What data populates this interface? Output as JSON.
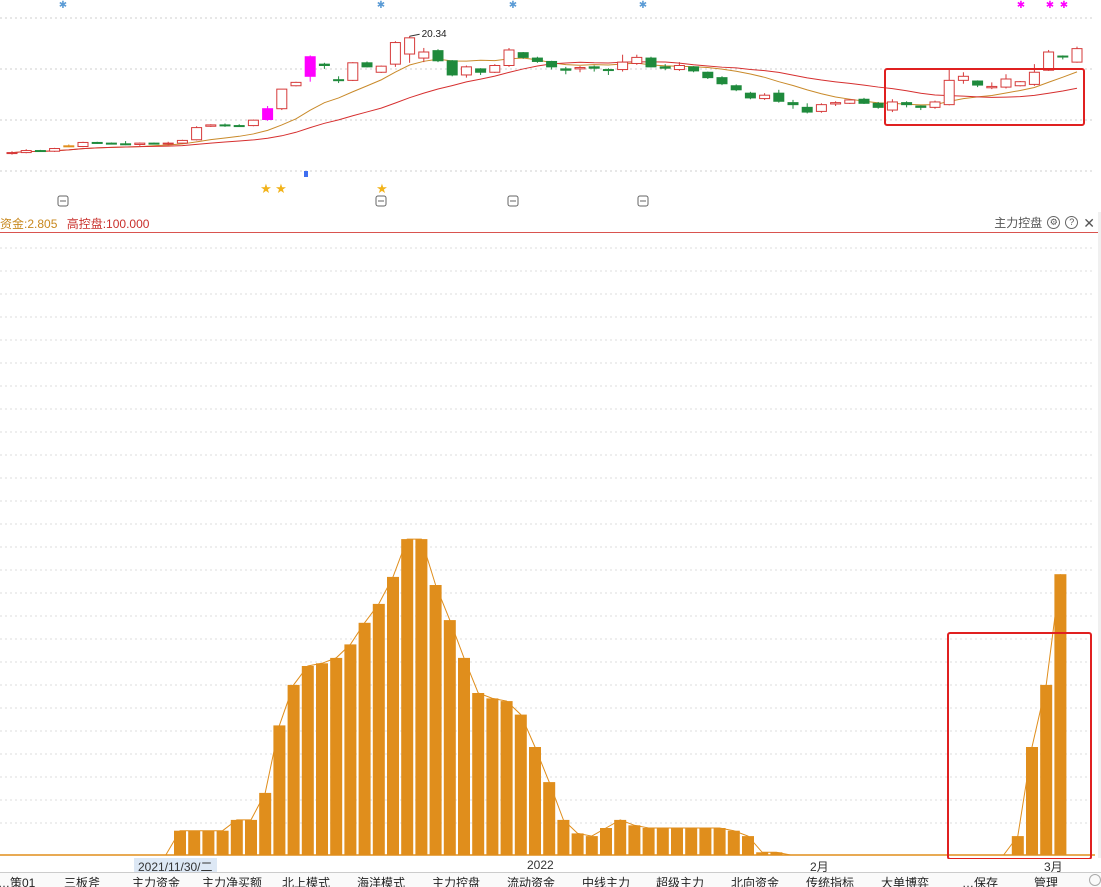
{
  "price_chart": {
    "high_label": "20.34",
    "candles": [
      [
        3.0,
        3.3,
        2.8,
        3.1
      ],
      [
        3.1,
        3.6,
        3.0,
        3.4
      ],
      [
        3.4,
        3.5,
        3.2,
        3.3
      ],
      [
        3.3,
        3.8,
        3.2,
        3.7
      ],
      [
        4.1,
        4.3,
        3.9,
        4.0
      ],
      [
        4.0,
        4.7,
        3.9,
        4.6
      ],
      [
        4.6,
        4.7,
        4.4,
        4.5
      ],
      [
        4.5,
        4.6,
        4.3,
        4.4
      ],
      [
        4.4,
        4.8,
        4.2,
        4.3
      ],
      [
        4.3,
        4.6,
        4.1,
        4.5
      ],
      [
        4.5,
        4.6,
        4.3,
        4.4
      ],
      [
        4.4,
        4.7,
        4.2,
        4.5
      ],
      [
        4.5,
        5.0,
        4.4,
        4.9
      ],
      [
        5.0,
        7.0,
        4.9,
        6.8
      ],
      [
        7.0,
        7.3,
        6.9,
        7.2
      ],
      [
        7.2,
        7.4,
        6.9,
        7.1
      ],
      [
        7.1,
        7.3,
        6.9,
        7.0
      ],
      [
        7.1,
        8.0,
        7.0,
        7.9
      ],
      [
        8.0,
        10.0,
        7.8,
        9.6
      ],
      [
        9.6,
        12.5,
        9.4,
        12.5
      ],
      [
        13.0,
        13.6,
        12.9,
        13.5
      ],
      [
        14.4,
        17.5,
        13.6,
        17.3
      ],
      [
        16.2,
        16.4,
        15.5,
        16.0
      ],
      [
        13.9,
        14.4,
        13.4,
        13.8
      ],
      [
        13.8,
        16.5,
        13.7,
        16.4
      ],
      [
        16.4,
        16.6,
        15.7,
        15.8
      ],
      [
        15.0,
        16.0,
        14.9,
        15.9
      ],
      [
        16.2,
        19.6,
        15.8,
        19.4
      ],
      [
        17.7,
        20.34,
        16.4,
        20.1
      ],
      [
        17.1,
        18.6,
        16.5,
        18.0
      ],
      [
        18.2,
        18.4,
        16.5,
        16.7
      ],
      [
        16.7,
        16.8,
        14.4,
        14.6
      ],
      [
        14.6,
        16.0,
        14.2,
        15.8
      ],
      [
        15.5,
        15.6,
        14.6,
        15.0
      ],
      [
        15.0,
        16.2,
        14.9,
        16.0
      ],
      [
        16.0,
        18.6,
        15.8,
        18.3
      ],
      [
        17.9,
        18.0,
        17.0,
        17.2
      ],
      [
        17.1,
        17.3,
        16.4,
        16.6
      ],
      [
        16.6,
        16.7,
        15.4,
        15.8
      ],
      [
        15.5,
        15.8,
        14.7,
        15.3
      ],
      [
        15.5,
        15.9,
        15.0,
        15.7
      ],
      [
        15.8,
        16.0,
        15.1,
        15.6
      ],
      [
        15.4,
        15.6,
        14.6,
        15.3
      ],
      [
        15.4,
        17.6,
        15.1,
        16.5
      ],
      [
        16.3,
        17.6,
        16.1,
        17.2
      ],
      [
        17.1,
        17.3,
        15.7,
        15.8
      ],
      [
        15.8,
        16.2,
        15.3,
        15.6
      ],
      [
        15.4,
        16.5,
        15.2,
        16.0
      ],
      [
        15.8,
        15.9,
        15.0,
        15.2
      ],
      [
        15.0,
        15.1,
        14.0,
        14.2
      ],
      [
        14.2,
        14.4,
        13.1,
        13.3
      ],
      [
        13.0,
        13.2,
        12.2,
        12.4
      ],
      [
        11.9,
        12.1,
        11.0,
        11.2
      ],
      [
        11.1,
        11.9,
        10.9,
        11.6
      ],
      [
        11.9,
        12.4,
        10.5,
        10.7
      ],
      [
        10.5,
        10.9,
        9.6,
        10.2
      ],
      [
        9.8,
        10.4,
        8.9,
        9.1
      ],
      [
        9.2,
        10.4,
        9.0,
        10.2
      ],
      [
        10.3,
        10.7,
        10.0,
        10.5
      ],
      [
        10.4,
        11.0,
        10.3,
        10.9
      ],
      [
        11.0,
        11.2,
        10.3,
        10.4
      ],
      [
        10.4,
        10.6,
        9.6,
        9.8
      ],
      [
        9.4,
        11.0,
        9.1,
        10.6
      ],
      [
        10.5,
        10.7,
        9.8,
        10.2
      ],
      [
        10.0,
        10.1,
        9.4,
        9.8
      ],
      [
        9.8,
        10.8,
        9.6,
        10.6
      ],
      [
        10.2,
        15.4,
        10.1,
        13.8
      ],
      [
        13.8,
        15.0,
        13.3,
        14.4
      ],
      [
        13.7,
        13.8,
        12.8,
        13.1
      ],
      [
        12.7,
        13.5,
        12.5,
        12.9
      ],
      [
        12.8,
        14.7,
        12.6,
        14.0
      ],
      [
        13.0,
        13.7,
        12.9,
        13.6
      ],
      [
        13.2,
        16.2,
        13.0,
        15.0
      ],
      [
        15.3,
        18.3,
        15.2,
        18.0
      ],
      [
        17.4,
        17.5,
        16.9,
        17.3
      ],
      [
        16.5,
        18.8,
        16.4,
        18.5
      ]
    ]
  },
  "indicator_header": {
    "left_value_1": "资金:2.805",
    "left_value_2": "高控盘:100.000",
    "title": "主力控盘",
    "settings_icon": "gear-icon",
    "help_icon": "question-icon",
    "close_icon": "close-icon"
  },
  "date_axis": {
    "cursor_date": "2021/11/30/二",
    "year_label": "2022",
    "month_2": "2月",
    "month_3": "3月"
  },
  "tabs": [
    "…策01",
    "三板斧",
    "主力资金",
    "主力净买额",
    "北上模式",
    "海洋模式",
    "主力控盘",
    "流动资金",
    "中线主力",
    "超级主力",
    "北向资金",
    "传统指标",
    "大单博弈",
    "…保存",
    "管理"
  ],
  "chart_data": {
    "type": "bar",
    "title": "主力控盘",
    "values": [
      0,
      0,
      0,
      0,
      0,
      0,
      0,
      0,
      0,
      0,
      0,
      0,
      9,
      9,
      9,
      9,
      13,
      13,
      23,
      48,
      63,
      70,
      71,
      73,
      78,
      86,
      93,
      103,
      117,
      117,
      100,
      87,
      73,
      60,
      58,
      57,
      52,
      40,
      27,
      13,
      8,
      7,
      10,
      13,
      11,
      10,
      10,
      10,
      10,
      10,
      10,
      9,
      7,
      1,
      1,
      0,
      0,
      0,
      0,
      0,
      0,
      0,
      0,
      0,
      0,
      0,
      0,
      0,
      0,
      0,
      0,
      7,
      40,
      63,
      104
    ],
    "line_marks": [
      {
        "index": 16,
        "label": "主力控盘"
      }
    ]
  },
  "colors": {
    "up": "#d63a3a",
    "down": "#1f8a3c",
    "bar": "#e08e1c",
    "ma_red": "#d62f2f",
    "ma_orange": "#c98a2a",
    "highlight_box": "#e02020",
    "magenta": "#ff00ff"
  }
}
